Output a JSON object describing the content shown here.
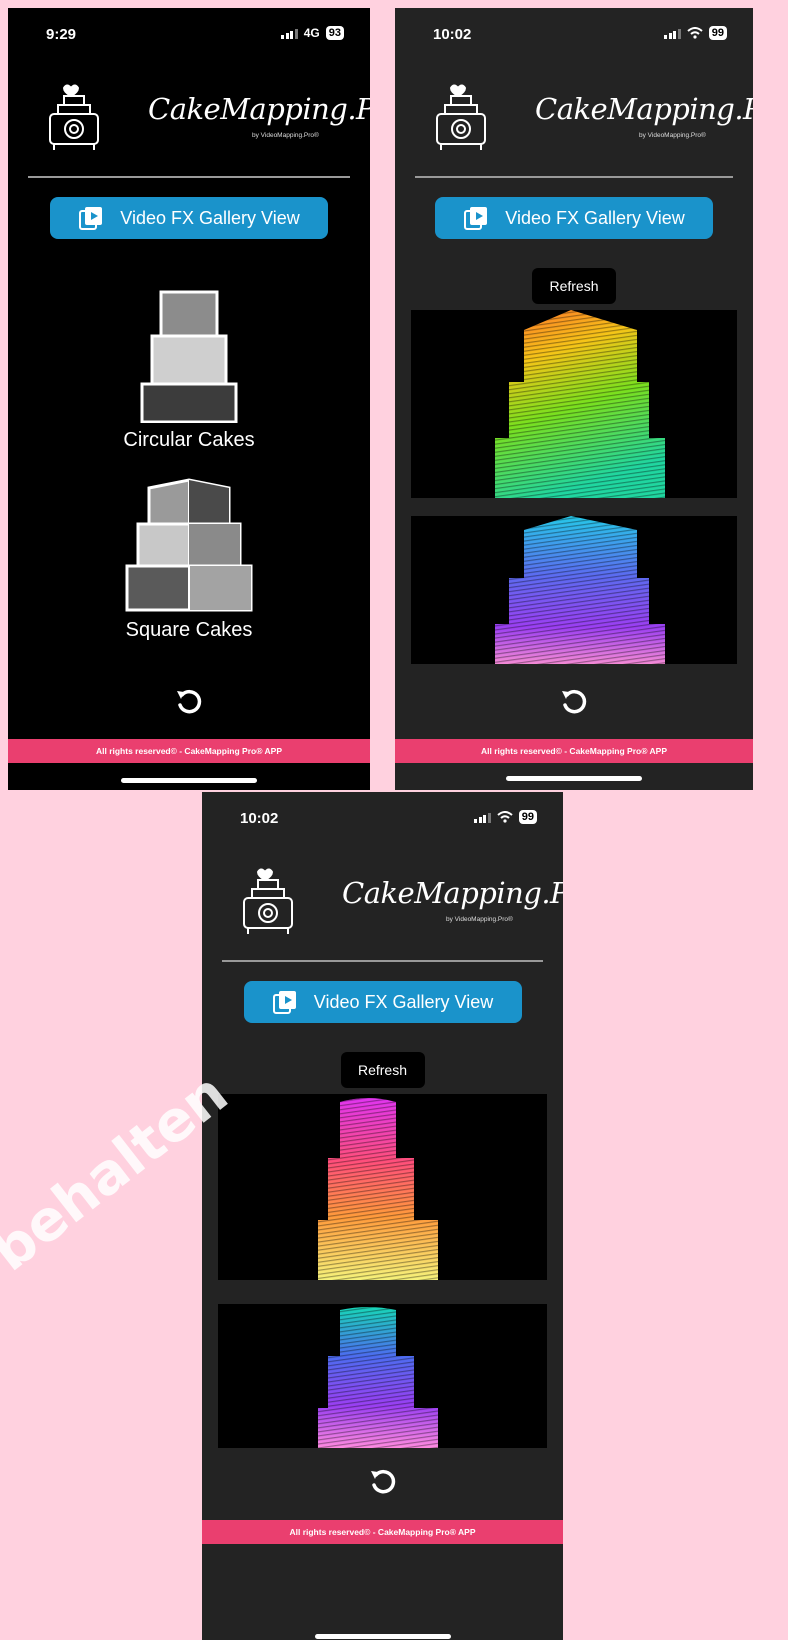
{
  "brand": {
    "name": "CakeMapping.Pro",
    "mark": "©",
    "subtitle": "by VideoMapping.Pro®"
  },
  "gallery_button_label": "Video FX Gallery View",
  "refresh_label": "Refresh",
  "footer_text": "All rights reserved© - CakeMapping Pro® APP",
  "screens": [
    {
      "time": "9:29",
      "network": "4G",
      "battery": "93"
    },
    {
      "time": "10:02",
      "battery": "99"
    },
    {
      "time": "10:02",
      "battery": "99"
    }
  ],
  "home": {
    "circular_label": "Circular Cakes",
    "square_label": "Square Cakes"
  },
  "watermark": "behalten",
  "colors": {
    "accent": "#1a93cb",
    "footer": "#ea3f6f",
    "background": "#ffd1df"
  }
}
